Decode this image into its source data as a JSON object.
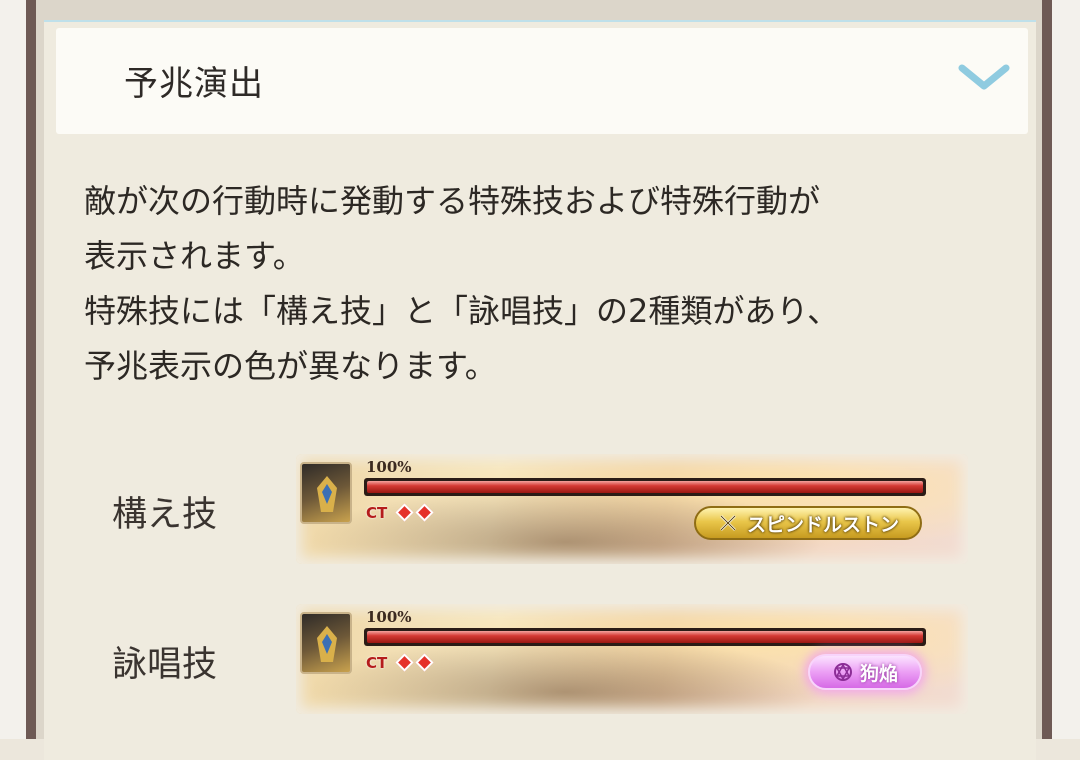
{
  "section": {
    "title": "予兆演出"
  },
  "description": {
    "lines": [
      "敵が次の行動時に発動する特殊技および特殊行動が",
      "表示されます。",
      "特殊技には「構え技」と「詠唱技」の2種類があり、",
      "予兆表示の色が異なります。"
    ]
  },
  "examples": [
    {
      "label": "構え技",
      "hp_text": "100%",
      "hp_percent": 100,
      "ct_label": "CT",
      "ct_count": 2,
      "skill_name": "スピンドルストン",
      "skill_icon": "crossed-swords-icon",
      "badge_color": "#e9c64a"
    },
    {
      "label": "詠唱技",
      "hp_text": "100%",
      "hp_percent": 100,
      "ct_label": "CT",
      "ct_count": 2,
      "skill_name": "狗焔",
      "skill_icon": "magic-circle-icon",
      "badge_color": "#ec9ff5"
    }
  ],
  "colors": {
    "accent_chevron": "#8fcbe0",
    "frame": "#6e5a55"
  }
}
